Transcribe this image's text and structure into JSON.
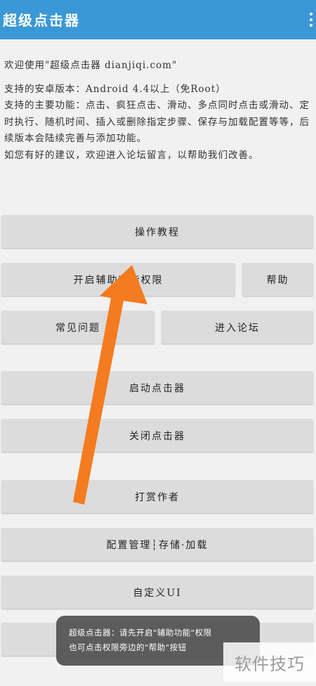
{
  "appbar": {
    "title": "超级点击器",
    "menu_icon": "more-vertical-icon"
  },
  "intro": {
    "welcome": "欢迎使用\"超级点击器 dianjiqi.com\"",
    "support_version": "支持的安卓版本：Android 4.4以上（免Root）",
    "features": "支持的主要功能：点击、疯狂点击、滑动、多点同时点击或滑动、定时执行、随机时间、插入或删除指定步骤、保存与加载配置等等，后续版本会陆续完善与添加功能。",
    "suggestion": "如您有好的建议，欢迎进入论坛留言，以帮助我们改善。"
  },
  "buttons": {
    "tutorial": "操作教程",
    "enable_accessibility": "开启辅助功能权限",
    "help": "帮助",
    "faq": "常见问题",
    "forum": "进入论坛",
    "start_clicker": "启动点击器",
    "stop_clicker": "关闭点击器",
    "tip_author": "打赏作者",
    "config_manage": "配置管理┆存储·加载",
    "custom_ui": "自定义UI"
  },
  "toast": {
    "line1": "超级点击器：请先开启\"辅助功能\"权限",
    "line2": "也可点击权限旁边的\"帮助\"按钮"
  },
  "watermark": "软件技巧",
  "colors": {
    "appbar": "#3b98d6",
    "button": "#dcdcdc",
    "background": "#f1f1f1",
    "arrow": "#f47b20",
    "toast": "#505050"
  }
}
